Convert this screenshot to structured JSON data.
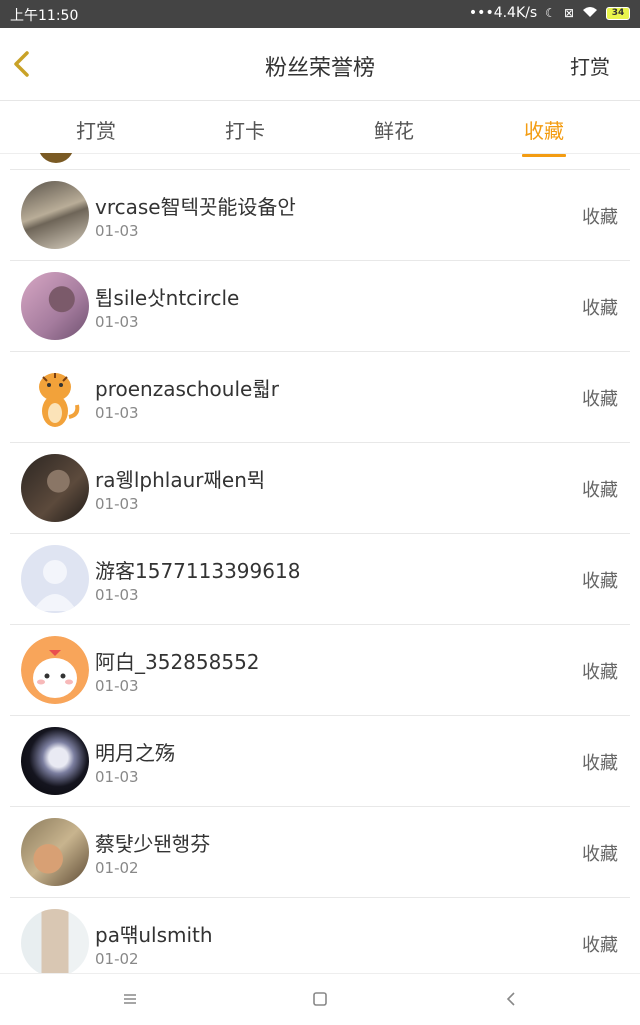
{
  "status_bar": {
    "time": "上午11:50",
    "speed": "4.4K/s",
    "battery": "34"
  },
  "header": {
    "title": "粉丝荣誉榜",
    "right_action": "打赏"
  },
  "tabs": [
    {
      "label": "打赏"
    },
    {
      "label": "打卡"
    },
    {
      "label": "鲜花"
    },
    {
      "label": "收藏"
    }
  ],
  "active_tab": "收藏",
  "list": [
    {
      "name": "vrcase智텍꼿能设备안",
      "date": "01-03",
      "action": "收藏"
    },
    {
      "name": "툅sile삿ntcircle",
      "date": "01-03",
      "action": "收藏"
    },
    {
      "name": "proenzaschoule뤏r",
      "date": "01-03",
      "action": "收藏"
    },
    {
      "name": "ra웽lphlaur째en뮉",
      "date": "01-03",
      "action": "收藏"
    },
    {
      "name": "游客1577113399618",
      "date": "01-03",
      "action": "收藏"
    },
    {
      "name": "阿白_352858552",
      "date": "01-03",
      "action": "收藏"
    },
    {
      "name": "明月之殇",
      "date": "01-03",
      "action": "收藏"
    },
    {
      "name": "蔡턏少됀행芬",
      "date": "01-02",
      "action": "收藏"
    },
    {
      "name": "pa떆ulsmith",
      "date": "01-02",
      "action": "收藏"
    }
  ],
  "colors": {
    "accent": "#f39c12",
    "status_bar": "#444444"
  },
  "icons": [
    "back-chevron-icon",
    "menu-icon",
    "home-square-icon",
    "back-nav-icon",
    "wifi-icon",
    "moon-icon",
    "battery-icon"
  ]
}
